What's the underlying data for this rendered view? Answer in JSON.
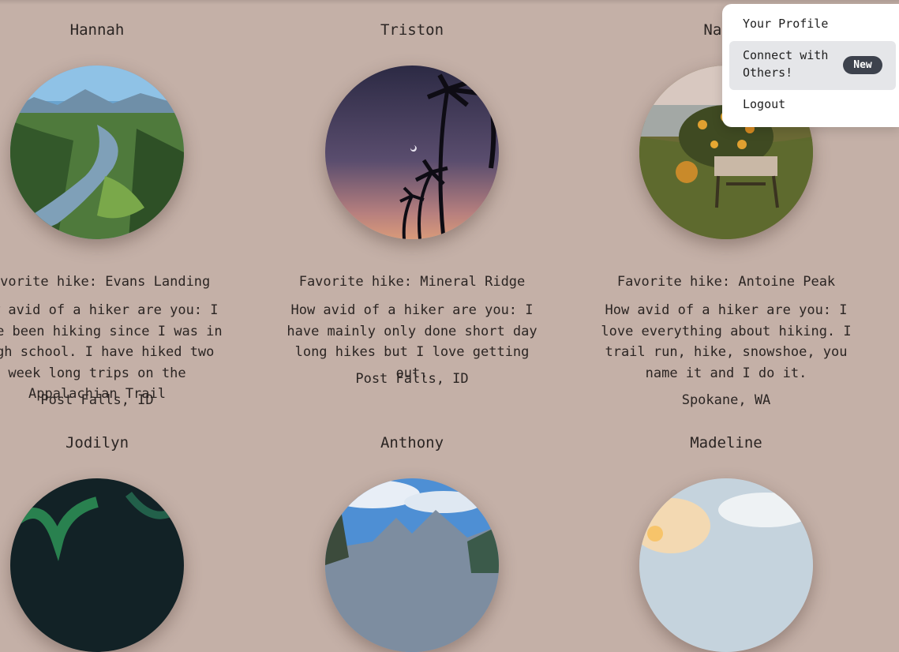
{
  "profiles": [
    {
      "name": "Hannah",
      "favorite_hike": "Favorite hike: Evans Landing",
      "bio": "How avid of a hiker are you: I have been hiking since I was in high school. I have hiked two week long trips on the Appalachian Trail",
      "location": "Post Falls, ID",
      "photo_icon": "river-valley-photo"
    },
    {
      "name": "Triston",
      "favorite_hike": "Favorite hike: Mineral Ridge",
      "bio": "How avid of a hiker are you: I have mainly only done short day long hikes but I love getting out.",
      "location": "Post Falls, ID",
      "photo_icon": "palm-trees-sunset-photo"
    },
    {
      "name": "Nadia",
      "favorite_hike": "Favorite hike: Antoine Peak",
      "bio": "How avid of a hiker are you: I love everything about hiking. I trail run, hike, snowshoe, you name it and I do it.",
      "location": "Spokane, WA",
      "photo_icon": "flowers-chair-photo"
    },
    {
      "name": "Jodilyn",
      "photo_icon": "aurora-photo"
    },
    {
      "name": "Anthony",
      "photo_icon": "mountain-forest-photo"
    },
    {
      "name": "Madeline",
      "photo_icon": "sunset-clouds-photo"
    }
  ],
  "menu": {
    "profile_label": "Your Profile",
    "connect_label": "Connect with Others!",
    "new_badge": "New",
    "logout_label": "Logout"
  },
  "colors": {
    "background": "#c4b0a7",
    "menu_bg": "#ffffff",
    "menu_active": "#e5e6e9",
    "badge": "#3d424d"
  }
}
